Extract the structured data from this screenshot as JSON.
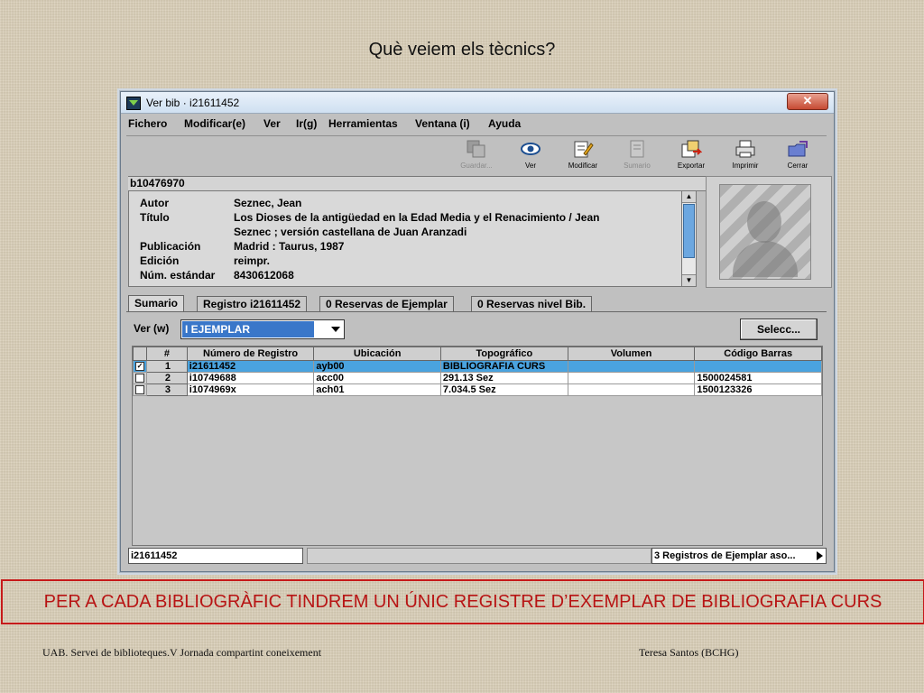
{
  "slide_title": "Què veiem els tècnics?",
  "window": {
    "title": "Ver bib · i21611452",
    "close_label": "✕",
    "menu": [
      "Fichero",
      "Modificar(e)",
      "Ver",
      "Ir(g)",
      "Herramientas",
      "Ventana (i)",
      "Ayuda"
    ],
    "toolbar": [
      {
        "label": "Guardar...",
        "icon": "save-icon",
        "enabled": false
      },
      {
        "label": "Ver",
        "icon": "eye-icon",
        "enabled": true
      },
      {
        "label": "Modificar",
        "icon": "edit-icon",
        "enabled": true
      },
      {
        "label": "Sumario",
        "icon": "summary-icon",
        "enabled": false
      },
      {
        "label": "Exportar",
        "icon": "export-icon",
        "enabled": true
      },
      {
        "label": "Imprimir",
        "icon": "printer-icon",
        "enabled": true
      },
      {
        "label": "Cerrar",
        "icon": "close-folder-icon",
        "enabled": true
      }
    ],
    "record_id": "b10476970",
    "bib": [
      {
        "label": "Autor",
        "value": "Seznec, Jean"
      },
      {
        "label": "Título",
        "value": "Los Dioses de la antigüedad en la Edad Media y el Renacimiento / Jean"
      },
      {
        "label": "",
        "value": "Seznec ; versión castellana de Juan Aranzadi"
      },
      {
        "label": "Publicación",
        "value": "Madrid : Taurus, 1987"
      },
      {
        "label": "Edición",
        "value": "reimpr."
      },
      {
        "label": "Núm. estándar",
        "value": "8430612068"
      }
    ],
    "tabs": [
      "Sumario",
      "Registro i21611452",
      "0 Reservas de Ejemplar",
      "0 Reservas nivel Bib."
    ],
    "ver_label": "Ver (w)",
    "ver_value": "I EJEMPLAR",
    "selecc_label": "Selecc...",
    "grid": {
      "columns": [
        "#",
        "Número de Registro",
        "Ubicación",
        "Topográfico",
        "Volumen",
        "Código Barras"
      ],
      "rows": [
        {
          "checked": true,
          "n": "1",
          "registro": "i21611452",
          "ubicacion": "ayb00",
          "topografico": "BIBLIOGRAFIA CURS",
          "volumen": "",
          "codigo": ""
        },
        {
          "checked": false,
          "n": "2",
          "registro": "i10749688",
          "ubicacion": "acc00",
          "topografico": "291.13 Sez",
          "volumen": "",
          "codigo": "1500024581"
        },
        {
          "checked": false,
          "n": "3",
          "registro": "i1074969x",
          "ubicacion": "ach01",
          "topografico": "7.034.5 Sez",
          "volumen": "",
          "codigo": "1500123326"
        }
      ]
    },
    "status_left": "i21611452",
    "status_right": "3 Registros de Ejemplar aso..."
  },
  "banner": "PER A CADA BIBLIOGRÀFIC TINDREM UN ÚNIC REGISTRE D’EXEMPLAR DE BIBLIOGRAFIA CURS",
  "footer_left": "UAB. Servei de biblioteques.V Jornada compartint coneixement",
  "footer_right": "Teresa Santos (BCHG)",
  "colors": {
    "banner_red": "#c61a1a",
    "selection_blue": "#4aa3df"
  }
}
